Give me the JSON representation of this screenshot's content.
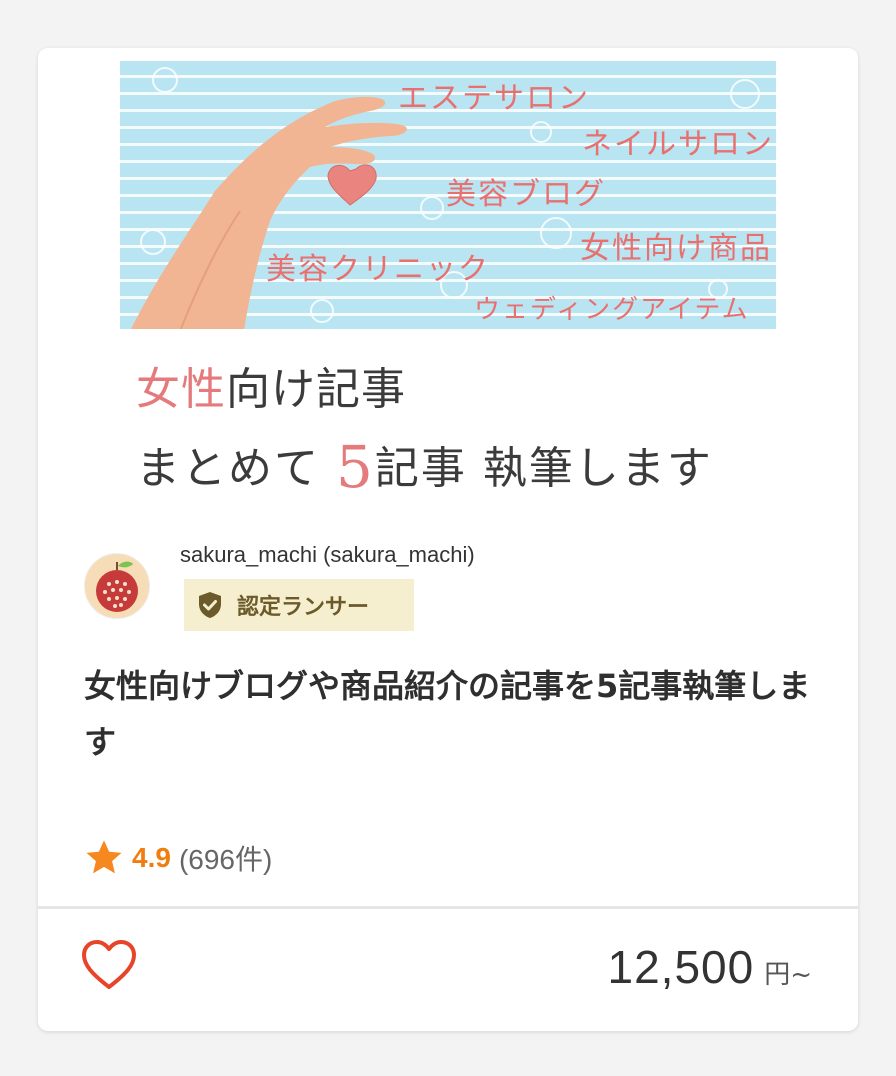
{
  "thumbnail": {
    "banner_words": [
      "エステサロン",
      "ネイルサロン",
      "美容ブログ",
      "女性向け商品",
      "美容クリニック",
      "ウェディングアイテム"
    ],
    "headline_pink": "女性",
    "headline_rest": "向け記事",
    "line2_pre": "まとめて ",
    "line2_num": "5",
    "line2_post": "記事 執筆します"
  },
  "seller": {
    "name": "sakura_machi (sakura_machi)",
    "badge": "認定ランサー"
  },
  "title": "女性向けブログや商品紹介の記事を5記事執筆します",
  "rating": {
    "value": "4.9",
    "count": "(696件)"
  },
  "price": {
    "value": "12,500",
    "unit": "円~"
  },
  "colors": {
    "accent_orange": "#f07d10",
    "heart_red": "#e8442a",
    "badge_bg": "#f6efcf",
    "banner_blue": "#b9e5f3",
    "banner_text_pink": "#e8716f"
  },
  "icons": {
    "badge": "shield-check-icon",
    "rating": "star-icon",
    "favorite": "heart-outline-icon"
  }
}
